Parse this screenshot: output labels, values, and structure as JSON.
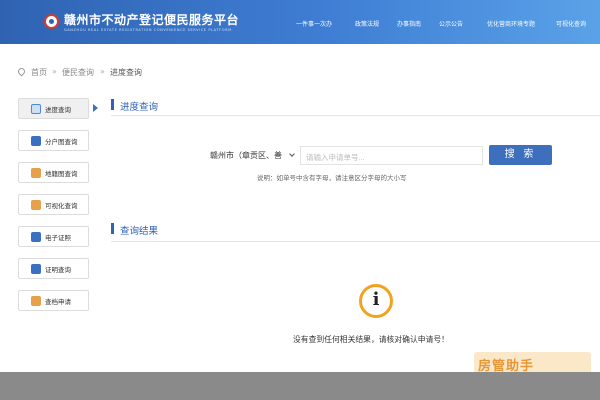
{
  "header": {
    "title": "赣州市不动产登记便民服务平台",
    "subtitle": "GANZHOU REAL ESTATE REGISTRATION CONVENIENCE SERVICE PLATFORM",
    "nav": [
      "一件事一次办",
      "政策法规",
      "办事指南",
      "公示公告",
      "优化营商环境专题",
      "可视化查询"
    ]
  },
  "breadcrumb": [
    "首页",
    "便民查询",
    "进度查询"
  ],
  "sidebar": {
    "items": [
      {
        "label": "进度查询",
        "icon": "progress-query-icon",
        "color": "#4c8ad8"
      },
      {
        "label": "分户图查询",
        "icon": "floor-plan-icon",
        "color": "#3b6fc1"
      },
      {
        "label": "地籍图查询",
        "icon": "cadastral-map-icon",
        "color": "#e6a04a"
      },
      {
        "label": "可视化查询",
        "icon": "visual-query-icon",
        "color": "#e6a04a"
      },
      {
        "label": "电子证照",
        "icon": "e-license-icon",
        "color": "#3b6fc1"
      },
      {
        "label": "证明查询",
        "icon": "certificate-query-icon",
        "color": "#3b6fc1"
      },
      {
        "label": "查档申请",
        "icon": "archive-request-icon",
        "color": "#e6a04a"
      }
    ]
  },
  "progress": {
    "section_title": "进度查询",
    "city_select": "赣州市（章贡区、善",
    "search_placeholder": "请输入申请单号...",
    "search_button": "搜 索",
    "hint": "说明：如单号中含有字母，请注意区分字母的大小写"
  },
  "result": {
    "section_title": "查询结果",
    "info_glyph": "i",
    "message": "没有查到任何相关结果，请核对确认申请号！"
  },
  "watermark": "房管助手",
  "colors": {
    "primary": "#2f63b2",
    "accent": "#f0a31f",
    "button": "#3d6fbd"
  }
}
